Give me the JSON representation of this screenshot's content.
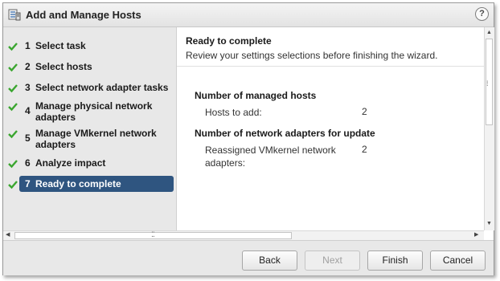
{
  "window": {
    "title": "Add and Manage Hosts",
    "help_icon": "help-icon",
    "help_glyph": "?"
  },
  "steps": [
    {
      "num": "1",
      "label": "Select task",
      "status": "complete"
    },
    {
      "num": "2",
      "label": "Select hosts",
      "status": "complete"
    },
    {
      "num": "3",
      "label": "Select network adapter tasks",
      "status": "complete"
    },
    {
      "num": "4",
      "label": "Manage physical network adapters",
      "status": "complete"
    },
    {
      "num": "5",
      "label": "Manage VMkernel network adapters",
      "status": "complete"
    },
    {
      "num": "6",
      "label": "Analyze impact",
      "status": "complete"
    },
    {
      "num": "7",
      "label": "Ready to complete",
      "status": "active"
    }
  ],
  "content": {
    "title": "Ready to complete",
    "subtitle": "Review your settings selections before finishing the wizard.",
    "sections": [
      {
        "title": "Number of managed hosts",
        "rows": [
          {
            "label": "Hosts to add:",
            "value": "2"
          }
        ]
      },
      {
        "title": "Number of network adapters for update",
        "rows": [
          {
            "label": "Reassigned VMkernel network adapters:",
            "value": "2"
          }
        ]
      }
    ]
  },
  "footer": {
    "back": "Back",
    "next": "Next",
    "finish": "Finish",
    "cancel": "Cancel"
  },
  "colors": {
    "active_step": "#2f5580",
    "check": "#3aa62f"
  }
}
